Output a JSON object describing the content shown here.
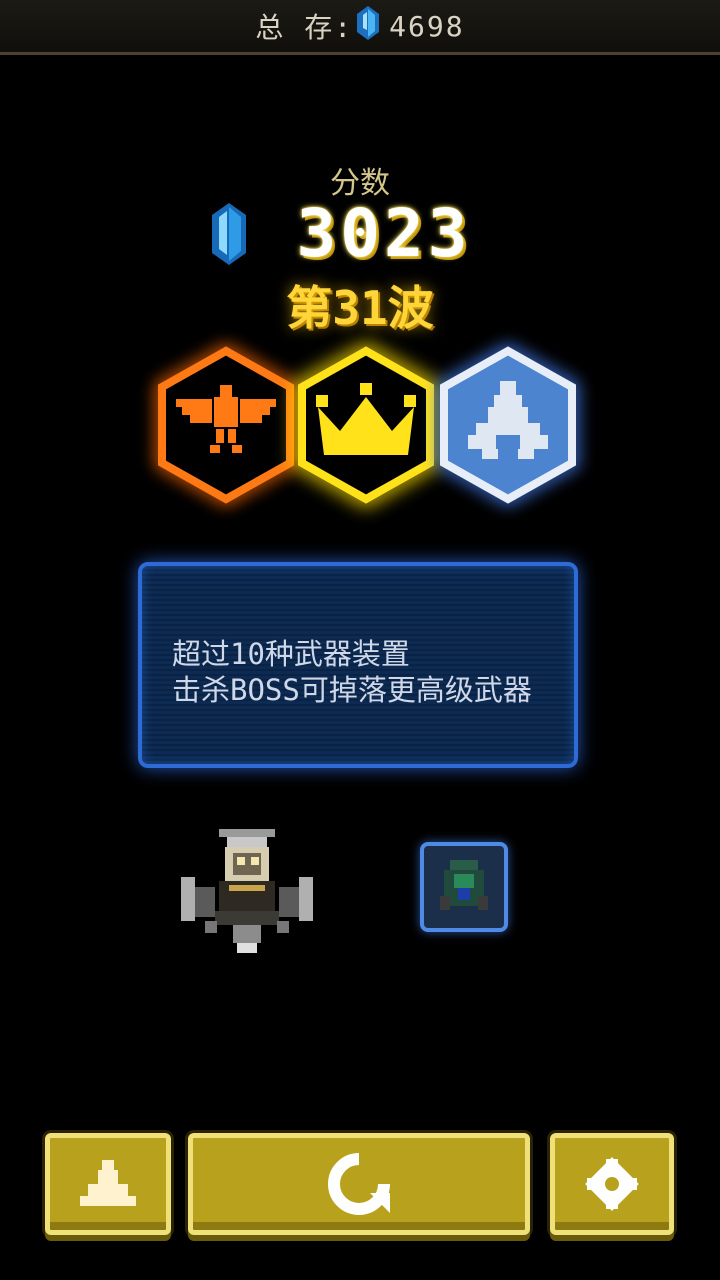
{
  "topbar": {
    "total_label": "总 存:",
    "total_value": "4698"
  },
  "score": {
    "label": "分数",
    "value": "3023"
  },
  "wave": {
    "label": "第31波"
  },
  "badges": [
    {
      "name": "eagle-badge",
      "color": "#ff7a14"
    },
    {
      "name": "crown-badge",
      "color": "#ffe21a"
    },
    {
      "name": "ship-badge",
      "color": "#5a8fdc"
    }
  ],
  "info": {
    "line1": "超过10种武器装置",
    "line2": "击杀BOSS可掉落更高级武器"
  },
  "buttons": {
    "ship_icon": "ship-icon",
    "restart_icon": "restart-icon",
    "settings_icon": "gear-icon"
  },
  "colors": {
    "button_gold": "#b8a11c",
    "panel_blue": "#2f6bd6",
    "gem_blue": "#3aa0e8"
  }
}
